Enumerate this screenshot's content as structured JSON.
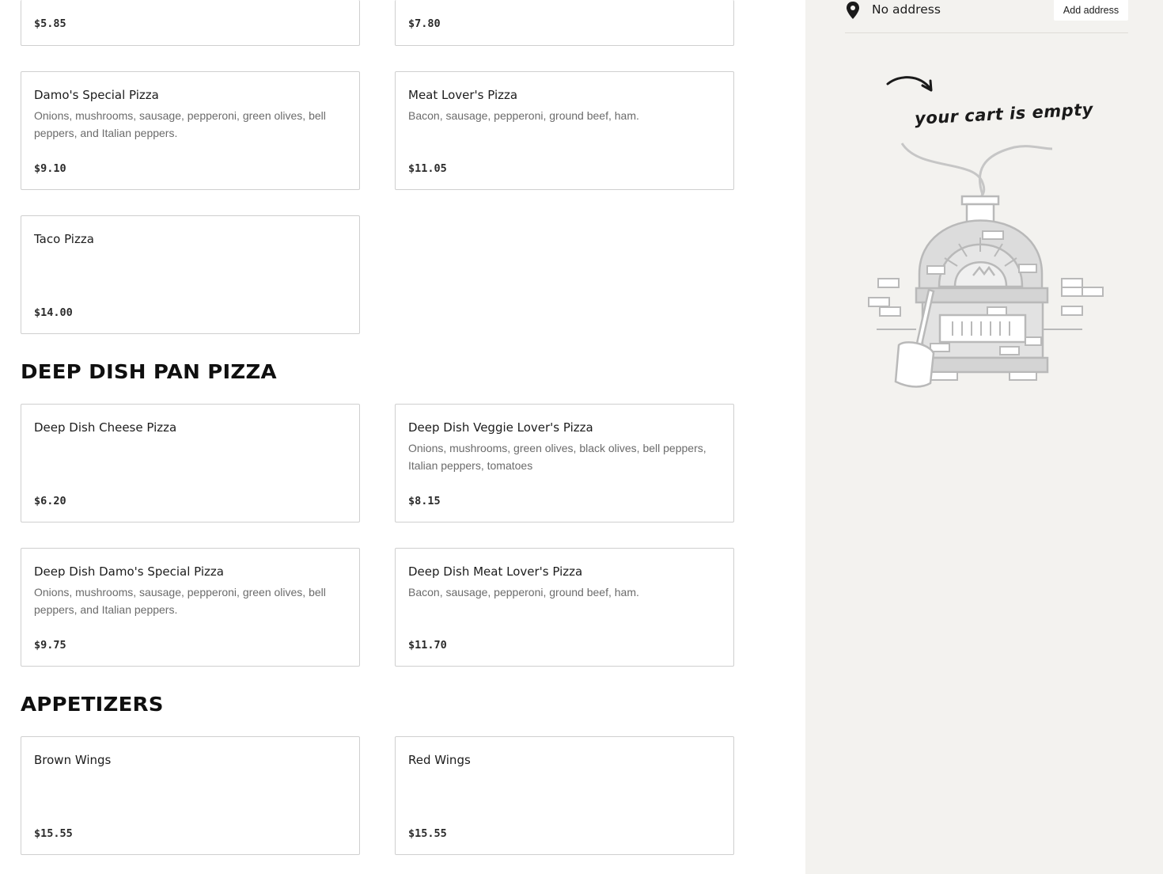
{
  "sections": [
    {
      "title": "DEEP DISH PAN PIZZA"
    },
    {
      "title": "APPETIZERS"
    }
  ],
  "items": [
    {
      "name": "",
      "desc": "",
      "price": "$5.85"
    },
    {
      "name": "",
      "desc": "",
      "price": "$7.80"
    },
    {
      "name": "Damo's Special Pizza",
      "desc": "Onions, mushrooms, sausage, pepperoni, green olives, bell peppers, and Italian peppers.",
      "price": "$9.10"
    },
    {
      "name": "Meat Lover's Pizza",
      "desc": "Bacon, sausage, pepperoni, ground beef, ham.",
      "price": "$11.05"
    },
    {
      "name": "Taco Pizza",
      "desc": "",
      "price": "$14.00"
    },
    {
      "name": "Deep Dish Cheese Pizza",
      "desc": "",
      "price": "$6.20"
    },
    {
      "name": "Deep Dish Veggie Lover's Pizza",
      "desc": "Onions, mushrooms, green olives, black olives, bell peppers, Italian peppers, tomatoes",
      "price": "$8.15"
    },
    {
      "name": "Deep Dish Damo's Special Pizza",
      "desc": "Onions, mushrooms, sausage, pepperoni, green olives, bell peppers, and Italian peppers.",
      "price": "$9.75"
    },
    {
      "name": "Deep Dish Meat Lover's Pizza",
      "desc": "Bacon, sausage, pepperoni, ground beef, ham.",
      "price": "$11.70"
    },
    {
      "name": "Brown Wings",
      "desc": "",
      "price": "$15.55"
    },
    {
      "name": "Red Wings",
      "desc": "",
      "price": "$15.55"
    }
  ],
  "cart": {
    "address_text": "No address",
    "add_address_label": "Add address",
    "empty_text": "your cart is empty",
    "icons": {
      "pin": "location-pin-icon",
      "oven": "pizza-oven-illustration"
    }
  },
  "colors": {
    "cart_bg": "#f3f2ef",
    "card_border": "#cfcfcf",
    "desc_text": "#6b6b6b"
  }
}
